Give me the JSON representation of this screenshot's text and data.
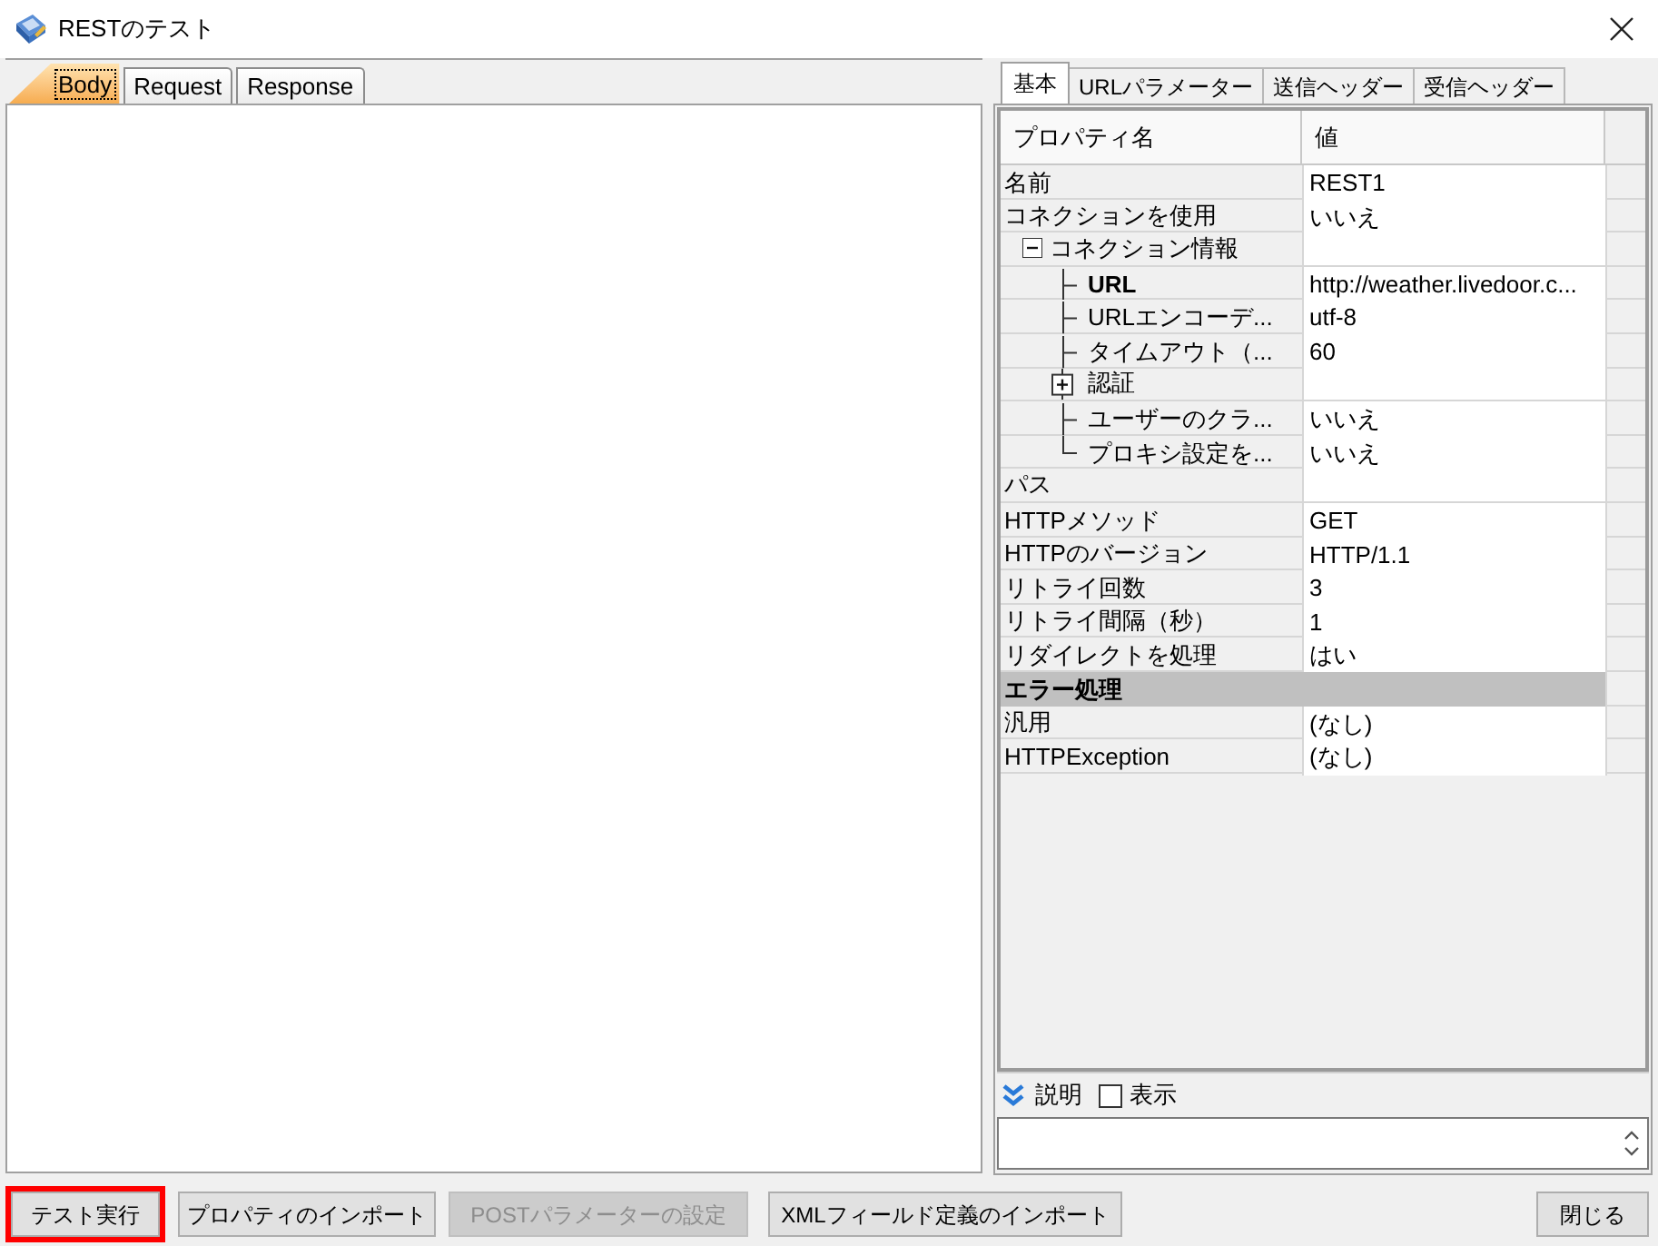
{
  "window": {
    "title": "RESTのテスト"
  },
  "left_tabs": [
    {
      "label": "Body",
      "selected": true
    },
    {
      "label": "Request",
      "selected": false
    },
    {
      "label": "Response",
      "selected": false
    }
  ],
  "right_tabs": [
    {
      "label": "基本",
      "selected": true
    },
    {
      "label": "URLパラメーター",
      "selected": false
    },
    {
      "label": "送信ヘッダー",
      "selected": false
    },
    {
      "label": "受信ヘッダー",
      "selected": false
    }
  ],
  "property_grid": {
    "columns": [
      "プロパティ名",
      "値"
    ],
    "rows": [
      {
        "kind": "property",
        "name": "名前",
        "value": "REST1",
        "bold": false
      },
      {
        "kind": "property",
        "name": "コネクションを使用",
        "value": "いいえ",
        "bold": false
      },
      {
        "kind": "property",
        "name": "コネクション情報",
        "bold": false,
        "expanded": true,
        "children": [
          {
            "kind": "property",
            "name": "URL",
            "value": "http://weather.livedoor.c...",
            "bold": true
          },
          {
            "kind": "property",
            "name": "URLエンコーデ...",
            "value": "utf-8",
            "bold": false
          },
          {
            "kind": "property",
            "name": "タイムアウト（...",
            "value": "60",
            "bold": false
          },
          {
            "kind": "property",
            "name": "認証",
            "bold": false,
            "expanded": false
          },
          {
            "kind": "property",
            "name": "ユーザーのクラ...",
            "value": "いいえ",
            "bold": false
          },
          {
            "kind": "property",
            "name": "プロキシ設定を...",
            "value": "いいえ",
            "bold": false
          }
        ]
      },
      {
        "kind": "property",
        "name": "パス",
        "bold": false
      },
      {
        "kind": "property",
        "name": "HTTPメソッド",
        "value": "GET",
        "bold": false
      },
      {
        "kind": "property",
        "name": "HTTPのバージョン",
        "value": "HTTP/1.1",
        "bold": false
      },
      {
        "kind": "property",
        "name": "リトライ回数",
        "value": "3",
        "bold": false
      },
      {
        "kind": "property",
        "name": "リトライ間隔（秒）",
        "value": "1",
        "bold": false
      },
      {
        "kind": "property",
        "name": "リダイレクトを処理",
        "value": "はい",
        "bold": false
      },
      {
        "kind": "category",
        "name": "エラー処理"
      },
      {
        "kind": "property",
        "name": "汎用",
        "value": "(なし)",
        "bold": false
      },
      {
        "kind": "property",
        "name": "HTTPException",
        "value": "(なし)",
        "bold": false
      }
    ]
  },
  "description": {
    "label": "説明",
    "checkbox": {
      "label": "表示",
      "checked": false
    }
  },
  "buttons": [
    {
      "label": "テスト実行",
      "disabled": false,
      "highlighted": true
    },
    {
      "label": "プロパティのインポート",
      "disabled": false,
      "highlighted": false
    },
    {
      "label": "POSTパラメーターの設定",
      "disabled": true,
      "highlighted": false
    },
    {
      "label": "XMLフィールド定義のインポート",
      "disabled": false,
      "highlighted": false
    },
    {
      "label": "閉じる",
      "disabled": false,
      "highlighted": false
    }
  ]
}
